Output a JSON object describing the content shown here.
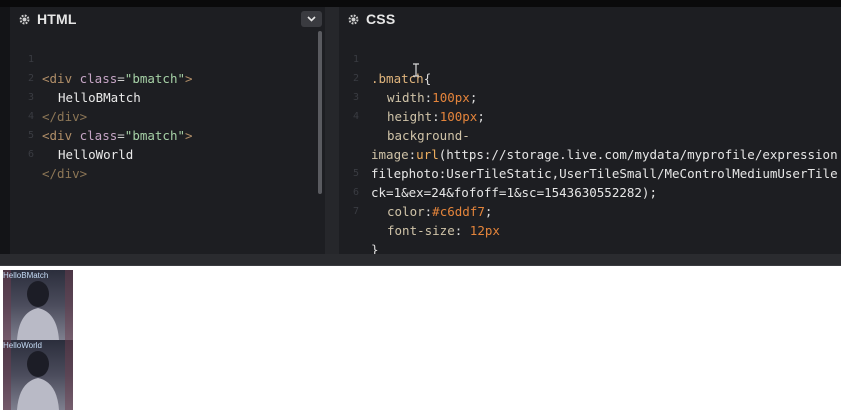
{
  "html_panel": {
    "title": "HTML",
    "lines": [
      {
        "num": "1",
        "open": "<div",
        "attr": " class",
        "eq": "=",
        "str": "\"bmatch\"",
        "close": ">"
      },
      {
        "num": "2",
        "text": "HelloBMatch"
      },
      {
        "num": "3",
        "endtag": "</div>"
      },
      {
        "num": "4",
        "open": "<div",
        "attr": " class",
        "eq": "=",
        "str": "\"bmatch\"",
        "close": ">"
      },
      {
        "num": "5",
        "text": "HelloWorld"
      },
      {
        "num": "6",
        "endtag": "</div>"
      }
    ]
  },
  "css_panel": {
    "title": "CSS",
    "selector": ".bmatch",
    "open_brace": "{",
    "close_brace": "}",
    "line_numbers": [
      "1",
      "2",
      "3",
      "4",
      "",
      "",
      "5",
      "6",
      "7"
    ],
    "width_prop": "width",
    "width_val": "100px",
    "height_prop": "height",
    "height_val": "100px",
    "bg_prop": "background-",
    "bg_prop2": "image",
    "url_fn": "url",
    "url_part1": "(https://storage.live.com/mydata/myprofile/expression",
    "url_part2": "filephoto:UserTileStatic,UserTileSmall/MeControlMediumUserTile",
    "url_part3": "ck=1&ex=24&fofoff=1&sc=1543630552282);",
    "color_prop": "color",
    "color_val": "#c6ddf7",
    "font_prop": "font-size",
    "font_val": "12px",
    "colon": ":",
    "colon_space": ": ",
    "semicolon": ";"
  },
  "preview": {
    "boxes": [
      {
        "label": "HelloBMatch"
      },
      {
        "label": "HelloWorld"
      }
    ]
  },
  "colors": {
    "editor_bg": "#1d1e22",
    "preview_bg": "#ffffff",
    "text_color": "#c6ddf7"
  }
}
